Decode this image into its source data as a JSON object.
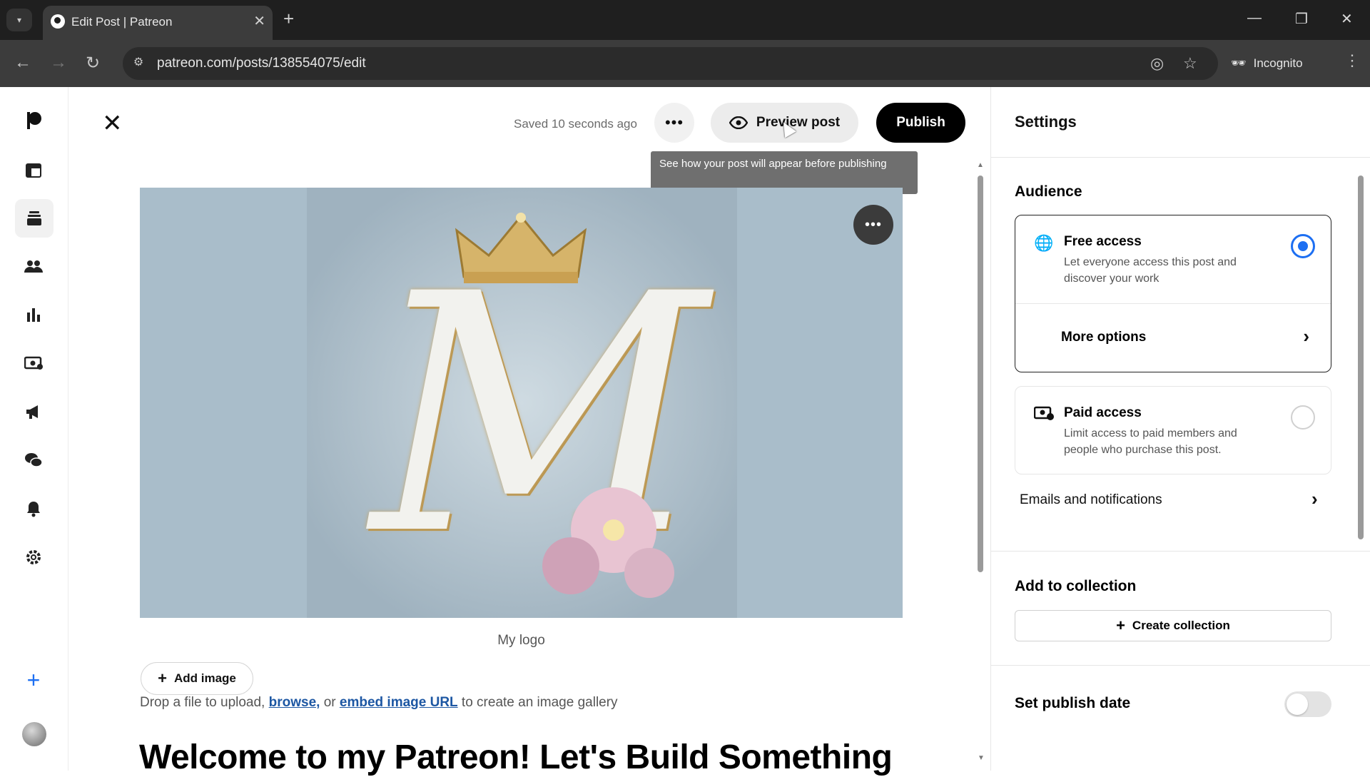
{
  "browser": {
    "tab_title": "Edit Post | Patreon",
    "tab_close": "✕",
    "new_tab": "+",
    "url": "patreon.com/posts/138554075/edit",
    "profile_label": "Incognito",
    "window_controls": [
      "—",
      "❐",
      "✕"
    ]
  },
  "leftnav": {
    "items": [
      "patreon-logo-icon",
      "dashboard-icon",
      "library-icon",
      "audience-icon",
      "insights-icon",
      "payouts-icon",
      "promotions-icon",
      "chats-icon",
      "notifications-icon",
      "settings-icon"
    ],
    "active": "library-icon",
    "create_label": "+"
  },
  "editor": {
    "close_label": "✕",
    "saved_status": "Saved 10 seconds ago",
    "more_label": "•••",
    "preview_label": "Preview post",
    "publish_label": "Publish",
    "tooltip": "See how your post will appear before publishing",
    "image_more_label": "•••",
    "image_caption": "My logo",
    "add_image_label": "Add image",
    "drop_prefix": "Drop a file to upload, ",
    "drop_browse": "browse,",
    "drop_or": " or ",
    "drop_embed": "embed image URL",
    "drop_suffix": " to create an image gallery",
    "post_title": "Welcome to my Patreon! Let's Build Something"
  },
  "settings": {
    "title": "Settings",
    "audience_title": "Audience",
    "free_access": {
      "name": "Free access",
      "description": "Let everyone access this post and discover your work",
      "selected": true
    },
    "more_options_label": "More options",
    "paid_access": {
      "name": "Paid access",
      "description": "Limit access to paid members and people who purchase this post.",
      "selected": false
    },
    "emails_label": "Emails and notifications",
    "collection_title": "Add to collection",
    "create_collection_label": "Create collection",
    "publish_date_label": "Set publish date",
    "publish_date_enabled": false
  },
  "colors": {
    "accent": "#1d6ff2",
    "link": "#1d57a3",
    "chrome_bg": "#1f1f1f"
  }
}
